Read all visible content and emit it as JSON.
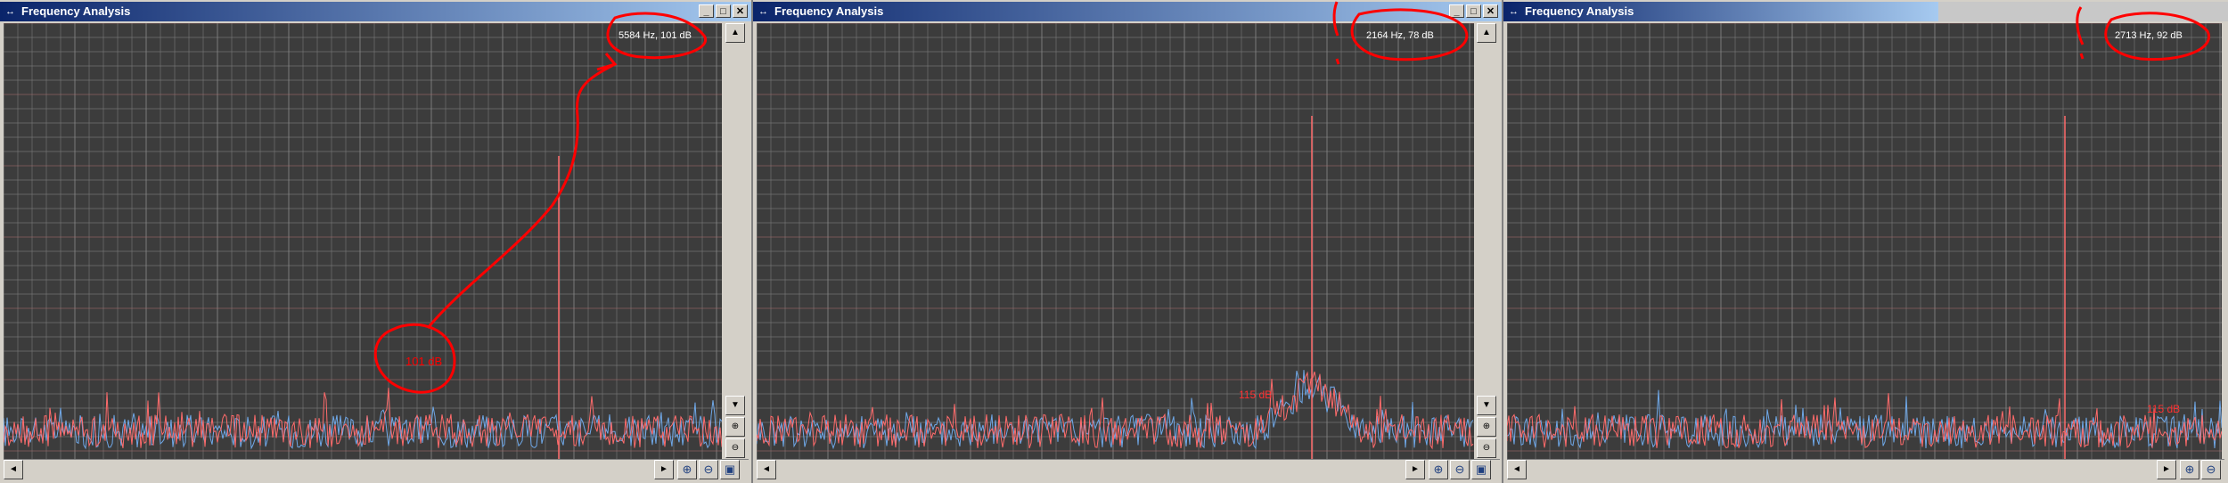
{
  "windows": [
    {
      "title": "Frequency Analysis",
      "readout": "5584 Hz, 101 dB",
      "annotation": "101 dB"
    },
    {
      "title": "Frequency Analysis",
      "readout": "2164 Hz, 78 dB",
      "annotation": "115 dB"
    },
    {
      "title": "Frequency Analysis",
      "readout": "2713 Hz, 92 dB",
      "annotation": "115 dB"
    }
  ],
  "icons": {
    "window": "resize-arrows-icon",
    "minimize": "minimize-icon",
    "maximize": "maximize-icon",
    "close": "close-icon",
    "zoom_in": "zoom-in-icon",
    "zoom_out": "zoom-out-icon",
    "zoom_fit": "zoom-fit-icon"
  },
  "colors": {
    "plot_bg": "#3c3c3c",
    "grid": "#8a8a8a",
    "series_red": "#ff6b6b",
    "series_blue": "#6fa8e8",
    "annotation": "#ff0000",
    "title_start": "#0a246a",
    "title_end": "#a6caf0"
  }
}
